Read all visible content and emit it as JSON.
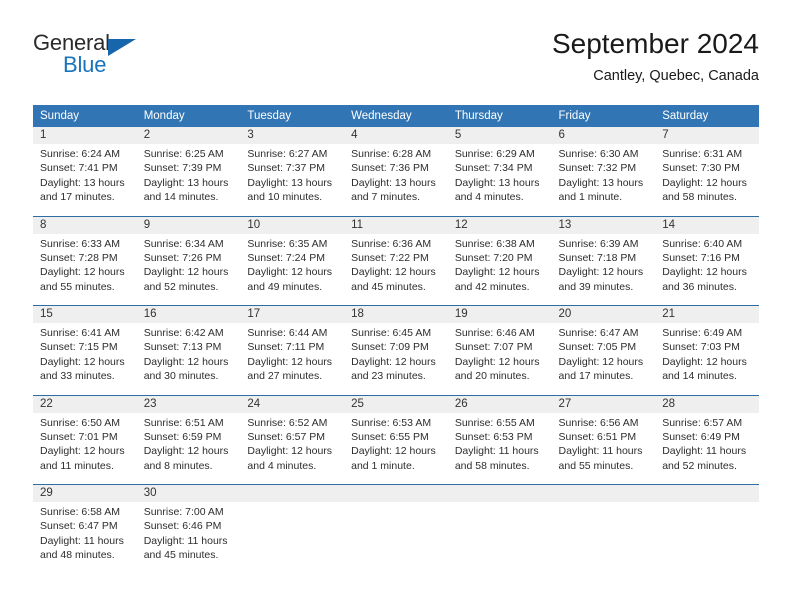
{
  "brand": {
    "name_part1": "General",
    "name_part2": "Blue",
    "accent_color": "#1974bc",
    "triangle_color": "#1766ab"
  },
  "header": {
    "title": "September 2024",
    "subtitle": "Cantley, Quebec, Canada"
  },
  "theme": {
    "header_row_background": "#3175b4",
    "header_row_text": "#ffffff",
    "daynumber_band_background": "#efefef",
    "row_divider": "#2e6da4"
  },
  "weekday_headers": [
    "Sunday",
    "Monday",
    "Tuesday",
    "Wednesday",
    "Thursday",
    "Friday",
    "Saturday"
  ],
  "weeks": [
    [
      {
        "day": "1",
        "sunrise": "Sunrise: 6:24 AM",
        "sunset": "Sunset: 7:41 PM",
        "daylight_line1": "Daylight: 13 hours",
        "daylight_line2": "and 17 minutes."
      },
      {
        "day": "2",
        "sunrise": "Sunrise: 6:25 AM",
        "sunset": "Sunset: 7:39 PM",
        "daylight_line1": "Daylight: 13 hours",
        "daylight_line2": "and 14 minutes."
      },
      {
        "day": "3",
        "sunrise": "Sunrise: 6:27 AM",
        "sunset": "Sunset: 7:37 PM",
        "daylight_line1": "Daylight: 13 hours",
        "daylight_line2": "and 10 minutes."
      },
      {
        "day": "4",
        "sunrise": "Sunrise: 6:28 AM",
        "sunset": "Sunset: 7:36 PM",
        "daylight_line1": "Daylight: 13 hours",
        "daylight_line2": "and 7 minutes."
      },
      {
        "day": "5",
        "sunrise": "Sunrise: 6:29 AM",
        "sunset": "Sunset: 7:34 PM",
        "daylight_line1": "Daylight: 13 hours",
        "daylight_line2": "and 4 minutes."
      },
      {
        "day": "6",
        "sunrise": "Sunrise: 6:30 AM",
        "sunset": "Sunset: 7:32 PM",
        "daylight_line1": "Daylight: 13 hours",
        "daylight_line2": "and 1 minute."
      },
      {
        "day": "7",
        "sunrise": "Sunrise: 6:31 AM",
        "sunset": "Sunset: 7:30 PM",
        "daylight_line1": "Daylight: 12 hours",
        "daylight_line2": "and 58 minutes."
      }
    ],
    [
      {
        "day": "8",
        "sunrise": "Sunrise: 6:33 AM",
        "sunset": "Sunset: 7:28 PM",
        "daylight_line1": "Daylight: 12 hours",
        "daylight_line2": "and 55 minutes."
      },
      {
        "day": "9",
        "sunrise": "Sunrise: 6:34 AM",
        "sunset": "Sunset: 7:26 PM",
        "daylight_line1": "Daylight: 12 hours",
        "daylight_line2": "and 52 minutes."
      },
      {
        "day": "10",
        "sunrise": "Sunrise: 6:35 AM",
        "sunset": "Sunset: 7:24 PM",
        "daylight_line1": "Daylight: 12 hours",
        "daylight_line2": "and 49 minutes."
      },
      {
        "day": "11",
        "sunrise": "Sunrise: 6:36 AM",
        "sunset": "Sunset: 7:22 PM",
        "daylight_line1": "Daylight: 12 hours",
        "daylight_line2": "and 45 minutes."
      },
      {
        "day": "12",
        "sunrise": "Sunrise: 6:38 AM",
        "sunset": "Sunset: 7:20 PM",
        "daylight_line1": "Daylight: 12 hours",
        "daylight_line2": "and 42 minutes."
      },
      {
        "day": "13",
        "sunrise": "Sunrise: 6:39 AM",
        "sunset": "Sunset: 7:18 PM",
        "daylight_line1": "Daylight: 12 hours",
        "daylight_line2": "and 39 minutes."
      },
      {
        "day": "14",
        "sunrise": "Sunrise: 6:40 AM",
        "sunset": "Sunset: 7:16 PM",
        "daylight_line1": "Daylight: 12 hours",
        "daylight_line2": "and 36 minutes."
      }
    ],
    [
      {
        "day": "15",
        "sunrise": "Sunrise: 6:41 AM",
        "sunset": "Sunset: 7:15 PM",
        "daylight_line1": "Daylight: 12 hours",
        "daylight_line2": "and 33 minutes."
      },
      {
        "day": "16",
        "sunrise": "Sunrise: 6:42 AM",
        "sunset": "Sunset: 7:13 PM",
        "daylight_line1": "Daylight: 12 hours",
        "daylight_line2": "and 30 minutes."
      },
      {
        "day": "17",
        "sunrise": "Sunrise: 6:44 AM",
        "sunset": "Sunset: 7:11 PM",
        "daylight_line1": "Daylight: 12 hours",
        "daylight_line2": "and 27 minutes."
      },
      {
        "day": "18",
        "sunrise": "Sunrise: 6:45 AM",
        "sunset": "Sunset: 7:09 PM",
        "daylight_line1": "Daylight: 12 hours",
        "daylight_line2": "and 23 minutes."
      },
      {
        "day": "19",
        "sunrise": "Sunrise: 6:46 AM",
        "sunset": "Sunset: 7:07 PM",
        "daylight_line1": "Daylight: 12 hours",
        "daylight_line2": "and 20 minutes."
      },
      {
        "day": "20",
        "sunrise": "Sunrise: 6:47 AM",
        "sunset": "Sunset: 7:05 PM",
        "daylight_line1": "Daylight: 12 hours",
        "daylight_line2": "and 17 minutes."
      },
      {
        "day": "21",
        "sunrise": "Sunrise: 6:49 AM",
        "sunset": "Sunset: 7:03 PM",
        "daylight_line1": "Daylight: 12 hours",
        "daylight_line2": "and 14 minutes."
      }
    ],
    [
      {
        "day": "22",
        "sunrise": "Sunrise: 6:50 AM",
        "sunset": "Sunset: 7:01 PM",
        "daylight_line1": "Daylight: 12 hours",
        "daylight_line2": "and 11 minutes."
      },
      {
        "day": "23",
        "sunrise": "Sunrise: 6:51 AM",
        "sunset": "Sunset: 6:59 PM",
        "daylight_line1": "Daylight: 12 hours",
        "daylight_line2": "and 8 minutes."
      },
      {
        "day": "24",
        "sunrise": "Sunrise: 6:52 AM",
        "sunset": "Sunset: 6:57 PM",
        "daylight_line1": "Daylight: 12 hours",
        "daylight_line2": "and 4 minutes."
      },
      {
        "day": "25",
        "sunrise": "Sunrise: 6:53 AM",
        "sunset": "Sunset: 6:55 PM",
        "daylight_line1": "Daylight: 12 hours",
        "daylight_line2": "and 1 minute."
      },
      {
        "day": "26",
        "sunrise": "Sunrise: 6:55 AM",
        "sunset": "Sunset: 6:53 PM",
        "daylight_line1": "Daylight: 11 hours",
        "daylight_line2": "and 58 minutes."
      },
      {
        "day": "27",
        "sunrise": "Sunrise: 6:56 AM",
        "sunset": "Sunset: 6:51 PM",
        "daylight_line1": "Daylight: 11 hours",
        "daylight_line2": "and 55 minutes."
      },
      {
        "day": "28",
        "sunrise": "Sunrise: 6:57 AM",
        "sunset": "Sunset: 6:49 PM",
        "daylight_line1": "Daylight: 11 hours",
        "daylight_line2": "and 52 minutes."
      }
    ],
    [
      {
        "day": "29",
        "sunrise": "Sunrise: 6:58 AM",
        "sunset": "Sunset: 6:47 PM",
        "daylight_line1": "Daylight: 11 hours",
        "daylight_line2": "and 48 minutes."
      },
      {
        "day": "30",
        "sunrise": "Sunrise: 7:00 AM",
        "sunset": "Sunset: 6:46 PM",
        "daylight_line1": "Daylight: 11 hours",
        "daylight_line2": "and 45 minutes."
      },
      {
        "day": "",
        "sunrise": "",
        "sunset": "",
        "daylight_line1": "",
        "daylight_line2": ""
      },
      {
        "day": "",
        "sunrise": "",
        "sunset": "",
        "daylight_line1": "",
        "daylight_line2": ""
      },
      {
        "day": "",
        "sunrise": "",
        "sunset": "",
        "daylight_line1": "",
        "daylight_line2": ""
      },
      {
        "day": "",
        "sunrise": "",
        "sunset": "",
        "daylight_line1": "",
        "daylight_line2": ""
      },
      {
        "day": "",
        "sunrise": "",
        "sunset": "",
        "daylight_line1": "",
        "daylight_line2": ""
      }
    ]
  ]
}
